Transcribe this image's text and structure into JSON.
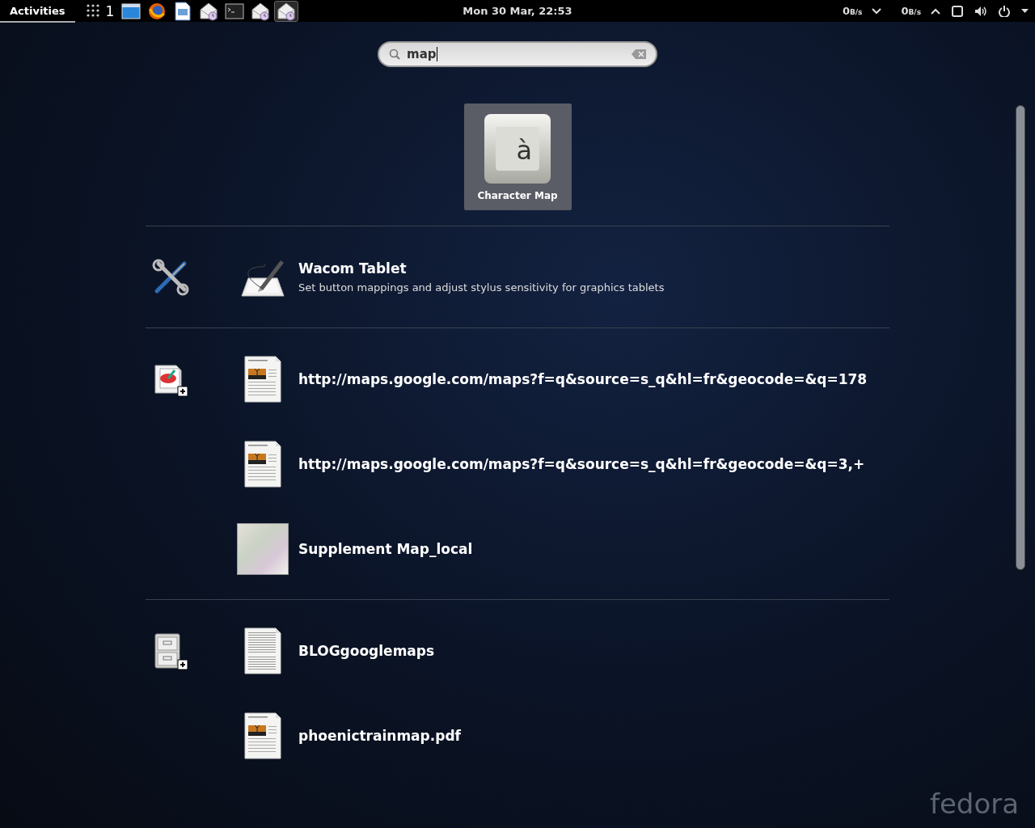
{
  "top_bar": {
    "activities": {
      "label": "Activities",
      "selected": true
    },
    "workspace": "1",
    "launchers": [
      {
        "kind": "window",
        "selected": false
      },
      {
        "kind": "browser",
        "selected": false
      },
      {
        "kind": "document",
        "selected": false
      },
      {
        "kind": "mail",
        "selected": false
      },
      {
        "kind": "terminal",
        "selected": false
      },
      {
        "kind": "mail",
        "selected": false
      },
      {
        "kind": "mail",
        "selected": true
      }
    ],
    "clock": "Mon 30 Mar, 22:53",
    "net_speeds": [
      {
        "value": "0",
        "unit": "B/s",
        "kind": "down"
      },
      {
        "value": "0",
        "unit": "B/s",
        "kind": "up"
      }
    ]
  },
  "search": {
    "value": "map"
  },
  "apps": [
    {
      "label": "Character Map",
      "glyph": "à",
      "selected": true
    }
  ],
  "sections": [
    {
      "kind": "tools",
      "results": [
        {
          "kind": "tablet",
          "title": "Wacom Tablet",
          "description": "Set button mappings and adjust stylus sensitivity for graphics tablets"
        }
      ]
    },
    {
      "kind": "documents",
      "results": [
        {
          "kind": "doc-image",
          "title": "http://maps.google.com/maps?f=q&source=s_q&hl=fr&geocode=&q=178"
        },
        {
          "kind": "doc-image",
          "title": "http://maps.google.com/maps?f=q&source=s_q&hl=fr&geocode=&q=3,+"
        },
        {
          "kind": "photo",
          "title": "Supplement Map_local"
        }
      ]
    },
    {
      "kind": "files",
      "results": [
        {
          "kind": "doc-text",
          "title": "BLOGgooglemaps"
        },
        {
          "kind": "doc-image",
          "title": "phoenictrainmap.pdf"
        }
      ]
    }
  ],
  "wallpaper_logo": "fedora"
}
